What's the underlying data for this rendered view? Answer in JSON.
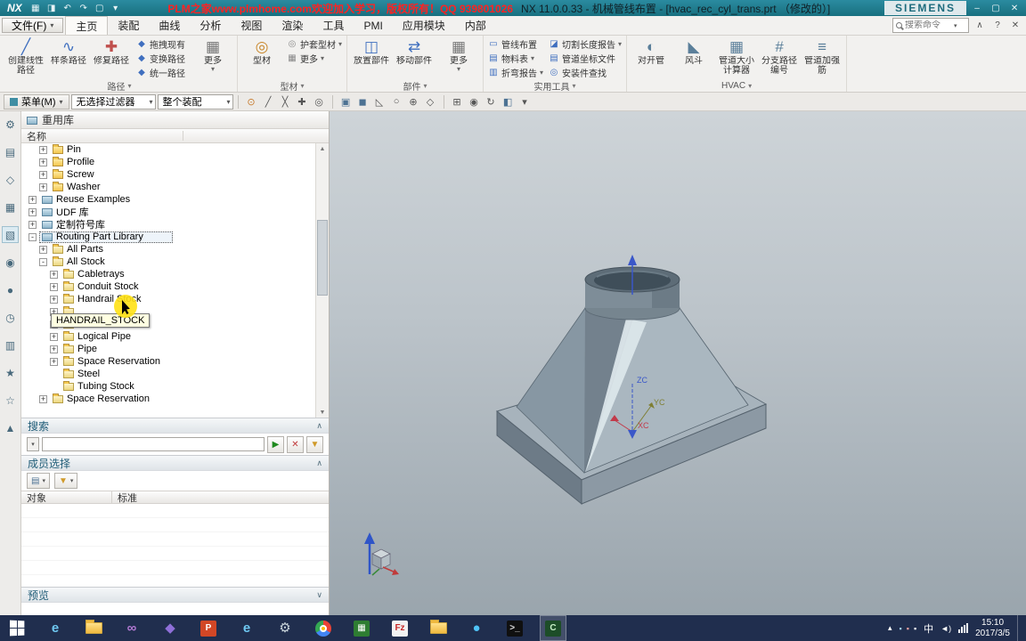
{
  "colors": {
    "titlebar": "#18707f",
    "watermark_red": "#ff2222",
    "taskbar": "#202e4e",
    "cursor_highlight_yellow": "#ffe114"
  },
  "ui": {
    "caret": "▾",
    "chevron_up": "∧",
    "chevron_down": "∨",
    "minimize": "–",
    "maximize": "▢",
    "close": "✕",
    "help": "?",
    "scroll_up": "▲",
    "scroll_down": "▼",
    "tray_expand": "▴",
    "volume": "◄)"
  },
  "title_bar": {
    "app_logo": "NX",
    "quick_icons": [
      {
        "name": "menu-grid-icon",
        "glyph": "▦"
      },
      {
        "name": "save-icon",
        "glyph": "◨"
      },
      {
        "name": "undo-icon",
        "glyph": "↶"
      },
      {
        "name": "redo-icon",
        "glyph": "↷"
      },
      {
        "name": "switch-window-icon",
        "glyph": "▢"
      },
      {
        "name": "more-commands-icon",
        "glyph": "▾"
      }
    ],
    "watermark": "PLM之家www.plmhome.com欢迎加入学习，版权所有！QQ 939801026",
    "doc_title": "NX 11.0.0.33 - 机械管线布置 - [hvac_rec_cyl_trans.prt （修改的）]",
    "brand": "SIEMENS"
  },
  "menu_bar": {
    "file_label": "文件(F)",
    "tabs": [
      {
        "label": "主页",
        "cls": "active"
      },
      {
        "label": "装配"
      },
      {
        "label": "曲线"
      },
      {
        "label": "分析"
      },
      {
        "label": "视图"
      },
      {
        "label": "渲染"
      },
      {
        "label": "工具"
      },
      {
        "label": "PMI"
      },
      {
        "label": "应用模块"
      },
      {
        "label": "内部"
      }
    ],
    "search_placeholder": "搜索命令"
  },
  "ribbon": {
    "groups": [
      {
        "label": "路径",
        "big": [
          {
            "label": "创建线性路径",
            "icon_name": "create-linear-path-icon",
            "glyph": "╱",
            "color": "#3f6fbf"
          },
          {
            "label": "样条路径",
            "icon_name": "spline-path-icon",
            "glyph": "∿",
            "color": "#3f6fbf"
          },
          {
            "label": "修复路径",
            "icon_name": "heal-path-icon",
            "glyph": "✚",
            "color": "#c0504d"
          }
        ],
        "small": [
          {
            "label": "拖拽现有",
            "icon_name": "drag-existing-icon",
            "glyph": "◆",
            "color": "#3f6fbf"
          },
          {
            "label": "变换路径",
            "icon_name": "transform-path-icon",
            "glyph": "◆",
            "color": "#3f6fbf"
          },
          {
            "label": "统一路径",
            "icon_name": "unify-path-icon",
            "glyph": "◆",
            "color": "#3f6fbf"
          }
        ],
        "more": {
          "label": "更多",
          "glyph": "▦"
        }
      },
      {
        "label": "型材",
        "big": [
          {
            "label": "型材",
            "icon_name": "stock-icon",
            "glyph": "◎",
            "color": "#c8862a"
          }
        ],
        "small": [
          {
            "label": "护套型材",
            "caret": "▾",
            "icon_name": "overstock-icon",
            "glyph": "◎",
            "color": "#888888"
          },
          {
            "label": "更多",
            "caret": "▾",
            "icon_name": "more-stock-icon",
            "glyph": "▦",
            "color": "#888888"
          }
        ]
      },
      {
        "label": "部件",
        "big": [
          {
            "label": "放置部件",
            "icon_name": "place-part-icon",
            "glyph": "◫",
            "color": "#3f6fbf"
          },
          {
            "label": "移动部件",
            "icon_name": "move-part-icon",
            "glyph": "⇄",
            "color": "#3f6fbf"
          }
        ],
        "more": {
          "label": "更多",
          "glyph": "▦"
        }
      },
      {
        "label": "实用工具",
        "small": [
          {
            "label": "管线布置",
            "icon_name": "routing-icon",
            "glyph": "▭",
            "color": "#3f6fbf"
          },
          {
            "label": "物料表",
            "caret": "▾",
            "icon_name": "bom-icon",
            "glyph": "▤",
            "color": "#3f6fbf"
          },
          {
            "label": "折弯报告",
            "caret": "▾",
            "icon_name": "bend-report-icon",
            "glyph": "▥",
            "color": "#3f6fbf"
          }
        ],
        "small2": [
          {
            "label": "切割长度报告",
            "caret": "▾",
            "icon_name": "cut-length-report-icon",
            "glyph": "◪",
            "color": "#3f6fbf"
          },
          {
            "label": "管道坐标文件",
            "icon_name": "pipe-coordinate-file-icon",
            "glyph": "▤",
            "color": "#3f6fbf"
          },
          {
            "label": "安装件查找",
            "icon_name": "fitting-find-icon",
            "glyph": "◎",
            "color": "#3f6fbf"
          }
        ]
      },
      {
        "label": "HVAC",
        "big": [
          {
            "label": "对开管",
            "icon_name": "split-duct-icon",
            "glyph": "◐",
            "color": "#5b7f9a"
          },
          {
            "label": "风斗",
            "icon_name": "air-scoop-icon",
            "glyph": "◣",
            "color": "#5b7f9a"
          },
          {
            "label": "管道大小计算器",
            "icon_name": "duct-size-calculator-icon",
            "glyph": "▦",
            "color": "#5b7f9a"
          },
          {
            "label": "分支路径编号",
            "icon_name": "branch-path-number-icon",
            "glyph": "#",
            "color": "#5b7f9a"
          },
          {
            "label": "管道加强筋",
            "icon_name": "duct-stiffener-icon",
            "glyph": "≡",
            "color": "#5b7f9a"
          }
        ]
      }
    ]
  },
  "toolbar2": {
    "menu_label": "菜单(M)",
    "filter_value": "无选择过滤器",
    "scope_value": "整个装配",
    "icon_groups": [
      [
        {
          "name": "snap-point-toggle-icon",
          "glyph": "⊙",
          "color": "#c77b2e"
        },
        {
          "name": "snap-endpoint-icon",
          "glyph": "╱",
          "color": "#555555"
        },
        {
          "name": "snap-midpoint-icon",
          "glyph": "╳",
          "color": "#555555"
        },
        {
          "name": "snap-intersection-icon",
          "glyph": "✚",
          "color": "#555555"
        },
        {
          "name": "snap-center-icon",
          "glyph": "◎",
          "color": "#555555"
        }
      ],
      [
        {
          "name": "select-face-icon",
          "glyph": "▣",
          "color": "#4d7293"
        },
        {
          "name": "select-body-icon",
          "glyph": "◼",
          "color": "#4d7293"
        },
        {
          "name": "select-edge-icon",
          "glyph": "◺",
          "color": "#555555"
        },
        {
          "name": "magnifier-icon",
          "glyph": "○",
          "color": "#555555"
        },
        {
          "name": "pan-icon",
          "glyph": "⊕",
          "color": "#555555"
        },
        {
          "name": "orient-view-icon",
          "glyph": "◇",
          "color": "#555555"
        }
      ],
      [
        {
          "name": "fit-view-icon",
          "glyph": "⊞",
          "color": "#555555"
        },
        {
          "name": "zoom-icon",
          "glyph": "◉",
          "color": "#555555"
        },
        {
          "name": "rotate-view-icon",
          "glyph": "↻",
          "color": "#555555"
        },
        {
          "name": "shaded-view-icon",
          "glyph": "◧",
          "color": "#4d7293"
        },
        {
          "name": "more-view-icon",
          "glyph": "▾",
          "color": "#555555"
        }
      ]
    ]
  },
  "resource_strip": {
    "icons": [
      {
        "name": "gear-icon",
        "glyph": "⚙"
      },
      {
        "name": "assembly-navigator-icon",
        "glyph": "▤"
      },
      {
        "name": "constraint-navigator-icon",
        "glyph": "◇"
      },
      {
        "name": "part-navigator-icon",
        "glyph": "▦"
      },
      {
        "name": "reuse-library-icon",
        "glyph": "▧",
        "cls": "active"
      },
      {
        "name": "hd3d-tool-icon",
        "glyph": "◉"
      },
      {
        "name": "web-browser-icon",
        "glyph": "●"
      },
      {
        "name": "history-icon",
        "glyph": "◷"
      },
      {
        "name": "process-studio-icon",
        "glyph": "▥"
      },
      {
        "name": "manufacturing-wizard-icon",
        "glyph": "★"
      },
      {
        "name": "roles-icon",
        "glyph": "☆"
      },
      {
        "name": "system-scene-icon",
        "glyph": "▲"
      }
    ]
  },
  "reuse_library": {
    "panel_title": "重用库",
    "column_header": "名称",
    "tooltip": "HANDRAIL_STOCK",
    "tree": [
      {
        "indent": 1,
        "expander": "+",
        "icon": "folder",
        "label": "Pin"
      },
      {
        "indent": 1,
        "expander": "+",
        "icon": "folder",
        "label": "Profile"
      },
      {
        "indent": 1,
        "expander": "+",
        "icon": "folder",
        "label": "Screw"
      },
      {
        "indent": 1,
        "expander": "+",
        "icon": "folder",
        "label": "Washer"
      },
      {
        "indent": 0,
        "expander": "+",
        "icon": "lib",
        "label": "Reuse Examples"
      },
      {
        "indent": 0,
        "expander": "+",
        "icon": "lib",
        "label": "UDF 库"
      },
      {
        "indent": 0,
        "expander": "+",
        "icon": "lib",
        "label": "定制符号库"
      },
      {
        "indent": 0,
        "expander": "-",
        "icon": "lib",
        "label": "Routing Part Library",
        "cls": "selected"
      },
      {
        "indent": 1,
        "expander": "+",
        "icon": "cat",
        "label": "All Parts"
      },
      {
        "indent": 1,
        "expander": "-",
        "icon": "cat",
        "label": "All Stock"
      },
      {
        "indent": 2,
        "expander": "+",
        "icon": "cat",
        "label": "Cabletrays"
      },
      {
        "indent": 2,
        "expander": "+",
        "icon": "cat",
        "label": "Conduit Stock"
      },
      {
        "indent": 2,
        "expander": "+",
        "icon": "cat",
        "label": "Handrail Stock"
      },
      {
        "indent": 2,
        "expander": "+",
        "icon": "cat",
        "label": ""
      },
      {
        "indent": 2,
        "expander": "+",
        "icon": "cat",
        "label": ""
      },
      {
        "indent": 2,
        "expander": "+",
        "icon": "cat",
        "label": "Logical Pipe"
      },
      {
        "indent": 2,
        "expander": "+",
        "icon": "cat",
        "label": "Pipe"
      },
      {
        "indent": 2,
        "expander": "+",
        "icon": "cat",
        "label": "Space Reservation"
      },
      {
        "indent": 2,
        "expander": "",
        "icon": "cat",
        "label": "Steel"
      },
      {
        "indent": 2,
        "expander": "",
        "icon": "cat",
        "label": "Tubing Stock"
      },
      {
        "indent": 1,
        "expander": "+",
        "icon": "cat",
        "label": "Space Reservation"
      }
    ]
  },
  "search": {
    "title": "搜索",
    "input_value": "",
    "buttons": [
      {
        "name": "search-go-button",
        "glyph": "▶",
        "color": "#1f8a1f"
      },
      {
        "name": "search-clear-button",
        "glyph": "✕",
        "color": "#c03a3a"
      },
      {
        "name": "search-filter-button",
        "glyph": "▼",
        "color": "#d09a2a"
      }
    ]
  },
  "member_select": {
    "title": "成员选择",
    "buttons": [
      {
        "name": "member-view-button",
        "glyph": "▤",
        "color": "#4d7293"
      },
      {
        "name": "member-filter-button",
        "glyph": "▼",
        "color": "#d09a2a"
      }
    ],
    "columns": [
      "对象",
      "标准"
    ]
  },
  "preview": {
    "title": "预览"
  },
  "viewport": {
    "axis_z": "ZC",
    "axis_y": "YC",
    "axis_x": "XC"
  },
  "taskbar": {
    "apps": [
      {
        "name": "taskbar-internet-explorer",
        "kind": "kind-glyph",
        "glyph": "e",
        "color": "#6fc9f2"
      },
      {
        "name": "taskbar-file-explorer",
        "kind": "kind-folder"
      },
      {
        "name": "taskbar-visual-studio",
        "kind": "kind-glyph",
        "glyph": "∞",
        "color": "#b57bd5"
      },
      {
        "name": "taskbar-app-purple",
        "kind": "kind-glyph",
        "glyph": "◆",
        "color": "#8e6fd8"
      },
      {
        "name": "taskbar-powerpoint",
        "kind": "kind-tile",
        "glyph": "P",
        "color": "#ffffff",
        "bg": "#d24726"
      },
      {
        "name": "taskbar-internet-explorer-2",
        "kind": "kind-glyph",
        "glyph": "e",
        "color": "#6fc9f2"
      },
      {
        "name": "taskbar-settings-gears",
        "kind": "kind-glyph",
        "glyph": "⚙",
        "color": "#c9d4da"
      },
      {
        "name": "taskbar-chrome",
        "kind": "kind-chrome"
      },
      {
        "name": "taskbar-app-green",
        "kind": "kind-tile",
        "glyph": "▦",
        "color": "#ffffff",
        "bg": "#2e7d32"
      },
      {
        "name": "taskbar-filezilla",
        "kind": "kind-tile",
        "glyph": "Fz",
        "color": "#c62828",
        "bg": "#f2f2f2"
      },
      {
        "name": "taskbar-folder-2",
        "kind": "kind-folder"
      },
      {
        "name": "taskbar-app-blue",
        "kind": "kind-glyph",
        "glyph": "●",
        "color": "#4fc3f7"
      },
      {
        "name": "taskbar-terminal",
        "kind": "kind-tile",
        "glyph": ">_",
        "color": "#dddddd",
        "bg": "#101010"
      },
      {
        "name": "taskbar-camtasia",
        "kind": "kind-tile active",
        "glyph": "C",
        "color": "#c8f0c8",
        "bg": "#1d4d28"
      }
    ],
    "tray": {
      "icons": [
        {
          "name": "tray-icon-1",
          "glyph": "▪",
          "color": "#9fd0f0"
        },
        {
          "name": "tray-icon-2",
          "glyph": "▪",
          "color": "#f0a0a0"
        },
        {
          "name": "tray-icon-3",
          "glyph": "▪",
          "color": "#ffffff"
        }
      ],
      "language": "中",
      "time": "15:10",
      "date": "2017/3/5"
    }
  }
}
